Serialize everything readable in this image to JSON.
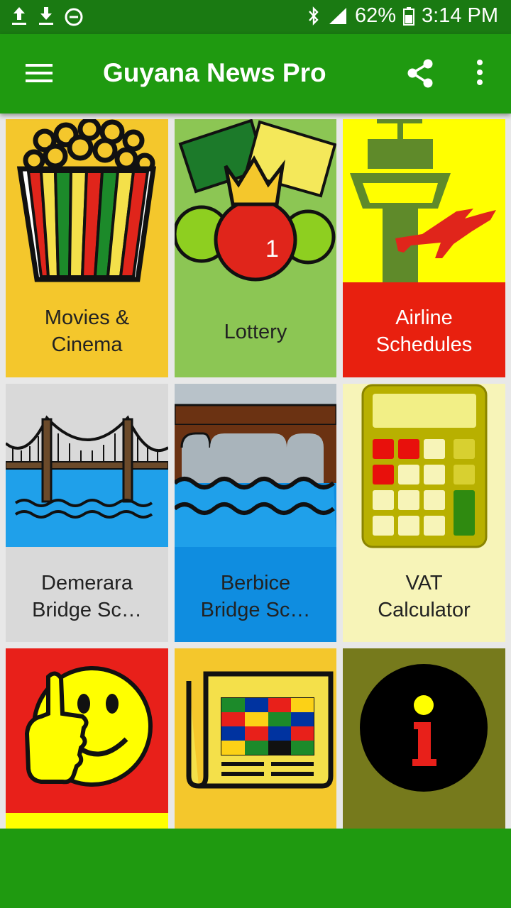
{
  "status_bar": {
    "left_icons": [
      "upload-icon",
      "download-icon",
      "do-not-disturb-icon"
    ],
    "right_icons": [
      "bluetooth-icon",
      "signal-icon",
      "battery-icon"
    ],
    "battery": "62%",
    "time": "3:14 PM"
  },
  "app_bar": {
    "title": "Guyana News Pro",
    "icons": [
      "menu-icon",
      "share-icon",
      "more-vert-icon"
    ],
    "color": "#1f9a10"
  },
  "tiles": [
    {
      "label_line1": "Movies &",
      "label_line2": "Cinema",
      "icon": "popcorn-icon"
    },
    {
      "label_line1": "Lottery",
      "label_line2": "",
      "icon": "lottery-balls-icon"
    },
    {
      "label_line1": "Airline",
      "label_line2": "Schedules",
      "icon": "control-tower-icon"
    },
    {
      "label_line1": "Demerara",
      "label_line2": "Bridge Sc…",
      "icon": "suspension-bridge-icon"
    },
    {
      "label_line1": "Berbice",
      "label_line2": "Bridge Sc…",
      "icon": "pontoon-bridge-icon"
    },
    {
      "label_line1": "VAT",
      "label_line2": "Calculator",
      "icon": "calculator-icon"
    },
    {
      "label_line1": "",
      "label_line2": "",
      "icon": "thumbs-up-smiley-icon"
    },
    {
      "label_line1": "",
      "label_line2": "",
      "icon": "newspaper-flags-icon"
    },
    {
      "label_line1": "",
      "label_line2": "",
      "icon": "info-icon"
    }
  ]
}
